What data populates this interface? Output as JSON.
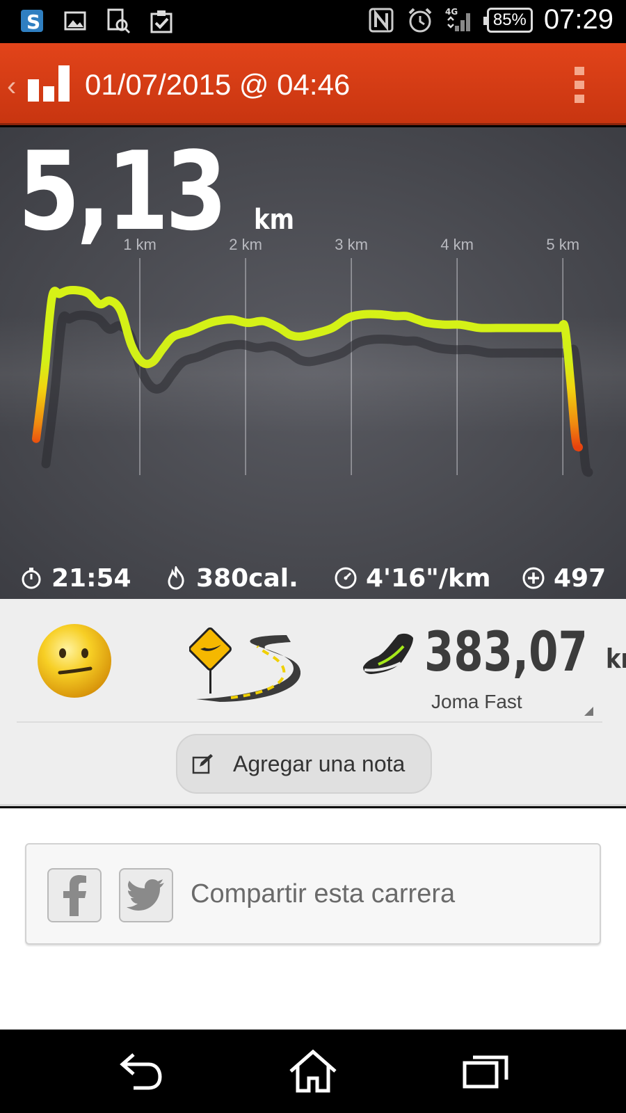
{
  "status_bar": {
    "battery": "85%",
    "time": "07:29",
    "network": "4G",
    "icons": [
      "s-app-icon",
      "gallery-icon",
      "screenshot-search-icon",
      "clipboard-check-icon",
      "nfc-icon",
      "alarm-icon",
      "signal-icon",
      "battery-icon"
    ]
  },
  "app_bar": {
    "title": "01/07/2015 @ 04:46",
    "icons": [
      "back-chevron-icon",
      "bar-chart-logo-icon",
      "overflow-menu-icon"
    ],
    "color": "#d63d15"
  },
  "run": {
    "distance_value": "5,13",
    "distance_unit": "km"
  },
  "chart_data": {
    "type": "line",
    "x_ticks": [
      "1 km",
      "2 km",
      "3 km",
      "4 km",
      "5 km"
    ],
    "xlim": [
      0,
      5.13
    ],
    "series": [
      {
        "x": [
          0.0,
          0.08,
          0.15,
          0.22,
          0.3,
          0.4,
          0.5,
          0.6,
          0.7,
          0.8,
          0.9,
          1.0,
          1.1,
          1.2,
          1.3,
          1.45,
          1.6,
          1.7,
          1.85,
          2.0,
          2.15,
          2.3,
          2.4,
          2.5,
          2.65,
          2.8,
          2.95,
          3.1,
          3.25,
          3.4,
          3.5,
          3.6,
          3.7,
          3.85,
          4.0,
          4.1,
          4.2,
          4.35,
          4.5,
          4.65,
          4.8,
          4.95,
          5.0,
          5.05,
          5.1,
          5.13
        ],
        "values": [
          0.05,
          0.45,
          0.88,
          0.9,
          0.92,
          0.92,
          0.9,
          0.84,
          0.86,
          0.8,
          0.6,
          0.5,
          0.5,
          0.58,
          0.65,
          0.68,
          0.72,
          0.74,
          0.75,
          0.73,
          0.74,
          0.7,
          0.66,
          0.65,
          0.67,
          0.7,
          0.76,
          0.78,
          0.78,
          0.77,
          0.77,
          0.75,
          0.73,
          0.72,
          0.72,
          0.71,
          0.7,
          0.7,
          0.7,
          0.7,
          0.7,
          0.7,
          0.7,
          0.4,
          0.05,
          0.0
        ]
      }
    ],
    "line_color_top": "#d7f216",
    "line_color_bottom": "#e8540e",
    "grid": true,
    "background": "#4b4c52"
  },
  "stats": {
    "time": "21:54",
    "calories": "380cal.",
    "pace": "4'16\"/km",
    "fuel": "497"
  },
  "details": {
    "mood": "neutral-smiley-icon",
    "terrain": "road-terrain-icon",
    "shoe_distance_value": "383,07",
    "shoe_distance_unit": "km",
    "shoe_name": "Joma Fast",
    "add_note_label": "Agregar una nota"
  },
  "share": {
    "label": "Compartir esta carrera",
    "networks": [
      "facebook-icon",
      "twitter-icon"
    ]
  },
  "nav_bar": {
    "buttons": [
      "back-nav-icon",
      "home-nav-icon",
      "recents-nav-icon"
    ]
  }
}
